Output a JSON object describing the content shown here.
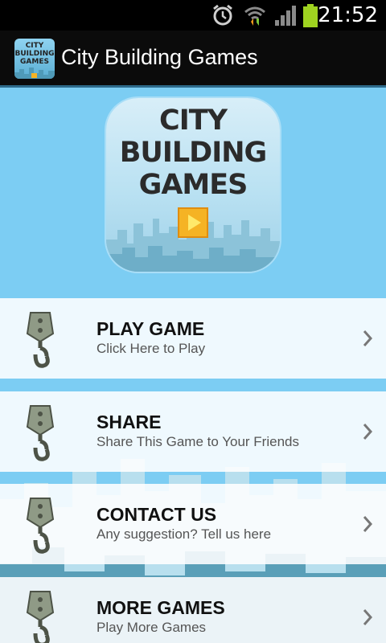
{
  "status_bar": {
    "time": "21:52",
    "icons": [
      "alarm-icon",
      "wifi-icon",
      "signal-icon",
      "battery-icon"
    ],
    "battery_color": "#9fd320"
  },
  "title_bar": {
    "title": "City Building Games",
    "icon_text": [
      "CITY",
      "BUILDING",
      "GAMES"
    ]
  },
  "logo": {
    "lines": [
      "CITY",
      "BUILDING",
      "GAMES"
    ],
    "play_icon": "play-icon"
  },
  "menu": {
    "items": [
      {
        "label": "PLAY GAME",
        "sub": "Click Here to Play",
        "icon": "crane-hook-icon"
      },
      {
        "label": "SHARE",
        "sub": "Share This Game to Your Friends",
        "icon": "crane-hook-icon"
      },
      {
        "label": "CONTACT US",
        "sub": "Any suggestion? Tell us here",
        "icon": "crane-hook-icon"
      },
      {
        "label": "MORE GAMES",
        "sub": "Play More Games",
        "icon": "crane-hook-icon"
      }
    ]
  },
  "colors": {
    "background": "#7ccdf3",
    "title_bar": "#0b0b0b",
    "accent": "#f5b324"
  }
}
